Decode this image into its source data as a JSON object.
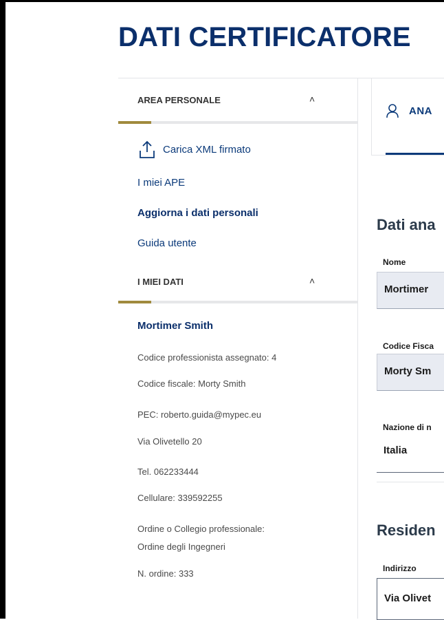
{
  "page": {
    "title": "DATI CERTIFICATORE"
  },
  "sidebar": {
    "area_personale": {
      "label": "AREA PERSONALE",
      "links": {
        "upload": "Carica XML firmato",
        "my_ape": "I miei APE",
        "update": "Aggiorna i dati personali",
        "guide": "Guida utente"
      }
    },
    "miei_dati": {
      "label": "I MIEI DATI",
      "name": "Mortimer Smith",
      "lines": [
        "Codice professionista assegnato: 4",
        "Codice fiscale: Morty Smith",
        "PEC: roberto.guida@mypec.eu",
        "Via Olivetello 20",
        "Tel. 062233444",
        "Cellulare: 339592255",
        "Ordine o Collegio professionale:",
        "Ordine degli Ingegneri",
        "N. ordine: 333"
      ]
    }
  },
  "main": {
    "tab": {
      "label": "ANA"
    },
    "section_anagrafici": "Dati ana",
    "fields": {
      "nome": {
        "label": "Nome",
        "value": "Mortimer"
      },
      "codice_fiscale": {
        "label": "Codice Fisca",
        "value": "Morty Sm"
      },
      "nazione": {
        "label": "Nazione di n",
        "value": "Italia"
      },
      "indirizzo": {
        "label": "Indirizzo",
        "value": "Via Olivet"
      }
    },
    "section_residenza": "Residen"
  },
  "colors": {
    "brand": "#0b2f6b",
    "accent": "#a08a3d"
  },
  "icons": {
    "chevron": "chevron-up-icon",
    "upload": "upload-icon",
    "user": "user-icon"
  }
}
